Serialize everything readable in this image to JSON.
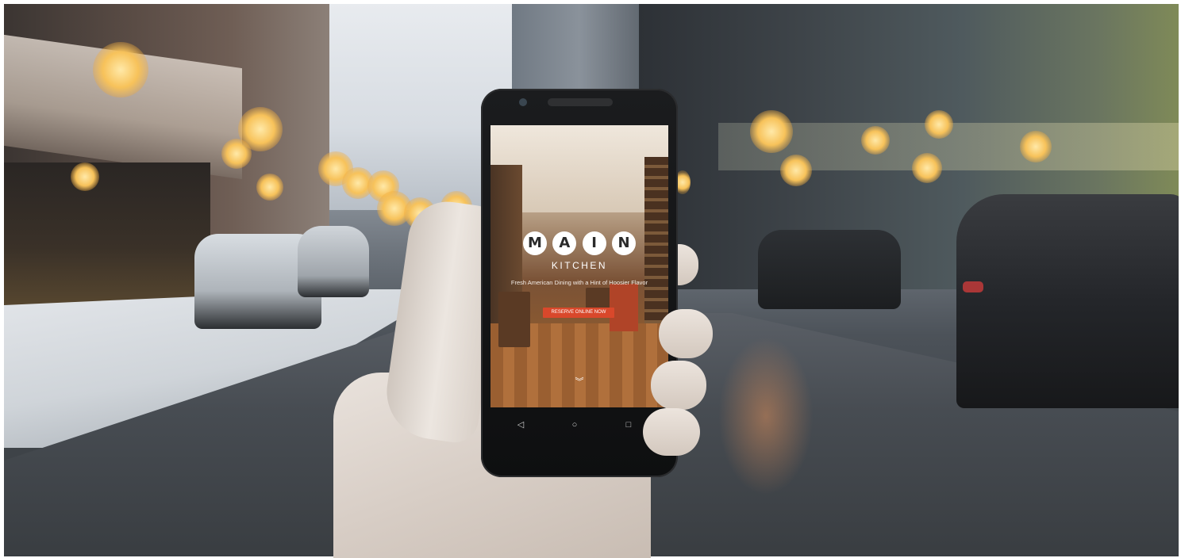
{
  "scene": {
    "description_icons": [
      "street-scene",
      "hand-holding-phone"
    ]
  },
  "phone_screen": {
    "logo_letters": [
      "M",
      "A",
      "I",
      "N"
    ],
    "logo_subtitle": "KITCHEN",
    "tagline": "Fresh American Dining with a Hint of Hoosier Flavor",
    "cta_label": "RESERVE ONLINE NOW",
    "scroll_icon": "chevron-double-down-icon",
    "accent_color": "#d9482b"
  },
  "android_nav": {
    "back_icon": "◁",
    "home_icon": "○",
    "recent_icon": "□"
  }
}
